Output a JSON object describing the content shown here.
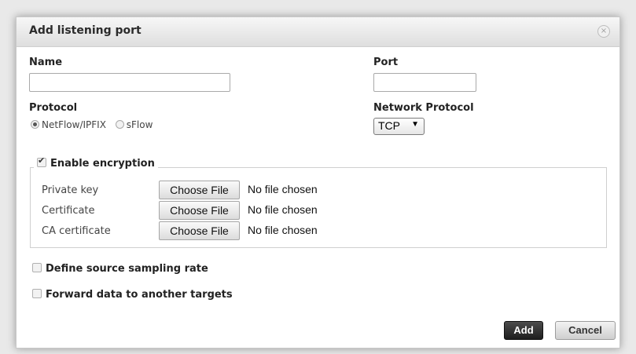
{
  "dialog": {
    "title": "Add listening port",
    "close_glyph": "×"
  },
  "name_field": {
    "label": "Name",
    "value": ""
  },
  "port_field": {
    "label": "Port",
    "value": ""
  },
  "protocol": {
    "label": "Protocol",
    "options": [
      "NetFlow/IPFIX",
      "sFlow"
    ],
    "selected": "NetFlow/IPFIX"
  },
  "network_protocol": {
    "label": "Network Protocol",
    "selected": "TCP",
    "arrow": "▼"
  },
  "encryption": {
    "label": "Enable encryption",
    "checked": true,
    "files": [
      {
        "label": "Private key",
        "button": "Choose File",
        "status": "No file chosen"
      },
      {
        "label": "Certificate",
        "button": "Choose File",
        "status": "No file chosen"
      },
      {
        "label": "CA certificate",
        "button": "Choose File",
        "status": "No file chosen"
      }
    ]
  },
  "options": {
    "sampling_rate": {
      "label": "Define source sampling rate",
      "checked": false
    },
    "forward_data": {
      "label": "Forward data to another targets",
      "checked": false
    }
  },
  "buttons": {
    "add": "Add",
    "cancel": "Cancel"
  },
  "icons": {
    "close": "close-icon",
    "dropdown": "chevron-down-icon",
    "check": "check-icon"
  },
  "colors": {
    "primary_button": "#2b2b2b",
    "titlebar": "#e4e4e4"
  }
}
